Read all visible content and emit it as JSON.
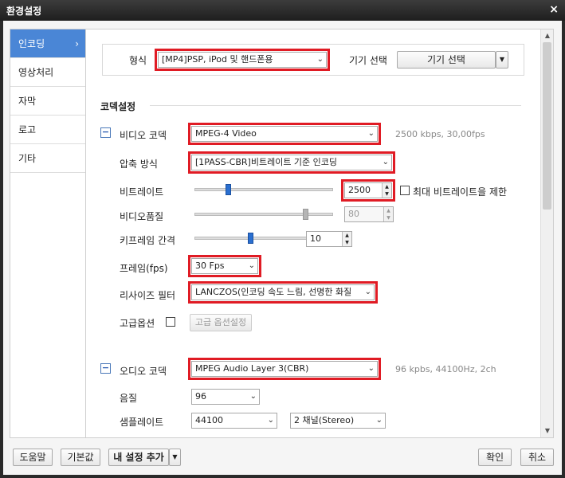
{
  "window": {
    "title": "환경설정",
    "close_label": "×"
  },
  "sidebar": {
    "items": [
      {
        "label": "인코딩",
        "chev": "›"
      },
      {
        "label": "영상처리"
      },
      {
        "label": "자막"
      },
      {
        "label": "로고"
      },
      {
        "label": "기타"
      }
    ]
  },
  "format": {
    "label": "형식",
    "value": "[MP4]PSP, iPod 및 핸드폰용",
    "device_label": "기기 선택",
    "device_button": "기기 선택"
  },
  "codec_section": {
    "title": "코덱설정"
  },
  "video": {
    "collapse": "−",
    "label": "비디오 코덱",
    "codec": "MPEG-4 Video",
    "info": "2500 kbps, 30,00fps",
    "compress_label": "압축 방식",
    "compress_value": "[1PASS-CBR]비트레이트 기준 인코딩",
    "bitrate_label": "비트레이트",
    "bitrate_value": "2500",
    "bitrate_level": 0.24,
    "max_bitrate_label": "최대 비트레이트을 제한",
    "quality_label": "비디오품질",
    "quality_value": "80",
    "quality_level": 0.8,
    "keyframe_label": "키프레임 간격",
    "keyframe_value": "10",
    "keyframe_level": 0.4,
    "fps_label": "프레임(fps)",
    "fps_value": "30 Fps",
    "resize_label": "리사이즈 필터",
    "resize_value": "LANCZOS(인코딩 속도 느림, 선명한 화질",
    "advanced_label": "고급옵션",
    "advanced_button": "고급 옵션설정"
  },
  "audio": {
    "collapse": "−",
    "label": "오디오 코덱",
    "codec": "MPEG Audio Layer 3(CBR)",
    "info": "96 kpbs, 44100Hz, 2ch",
    "quality_label": "음질",
    "quality_value": "96",
    "samplerate_label": "샘플레이트",
    "samplerate_value": "44100",
    "channel_value": "2 채널(Stereo)"
  },
  "footer": {
    "help": "도움말",
    "default": "기본값",
    "add_setting": "내 설정 추가",
    "ok": "확인",
    "cancel": "취소"
  },
  "icons": {
    "dropdown": "chevron-down-icon",
    "up": "triangle-up-icon",
    "down": "triangle-down-icon"
  },
  "colors": {
    "highlight": "#e01b24",
    "accent": "#4a86d6",
    "thumb": "#2a6fd0"
  }
}
